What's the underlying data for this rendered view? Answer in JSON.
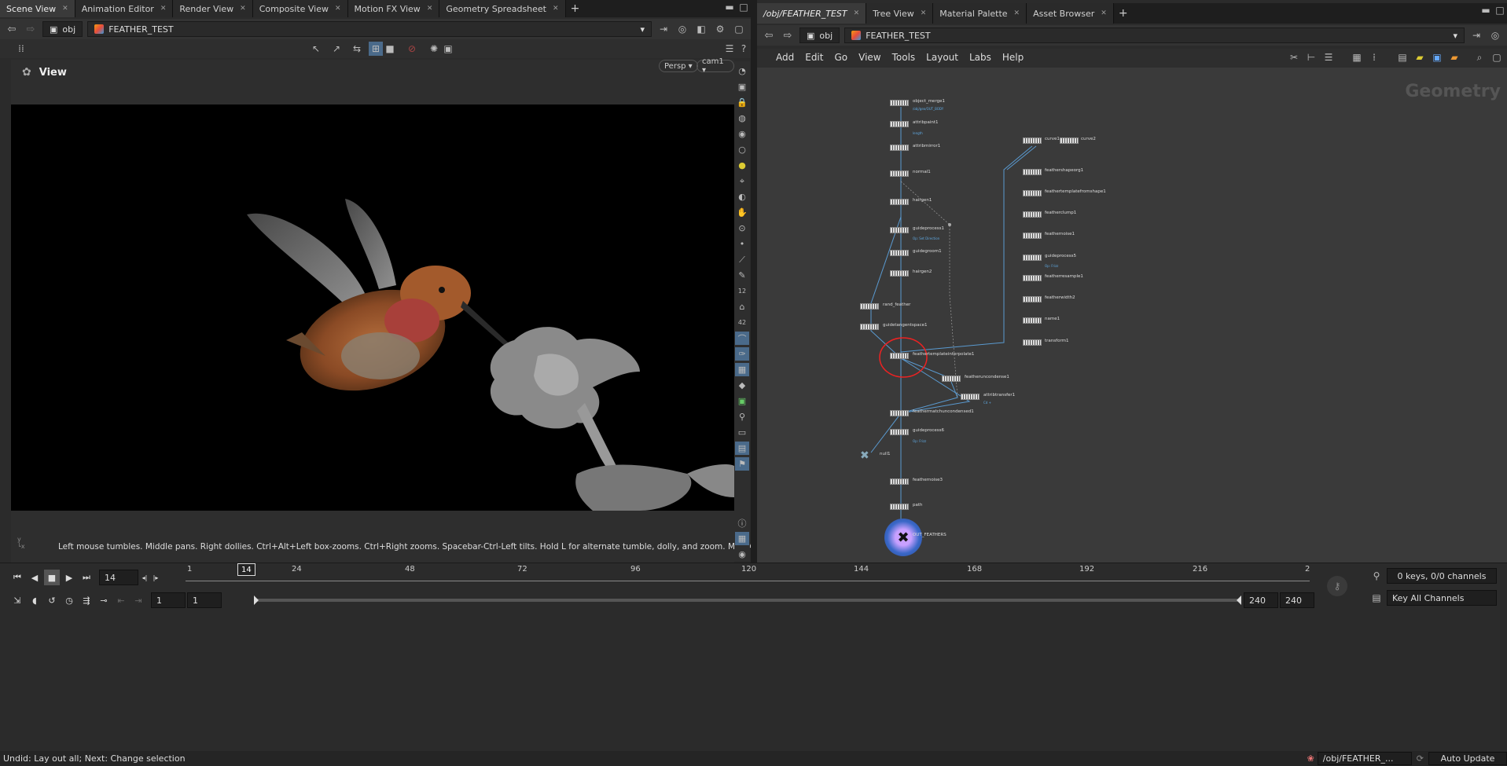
{
  "left_tabs": [
    {
      "label": "Scene View",
      "active": true
    },
    {
      "label": "Animation Editor",
      "active": false
    },
    {
      "label": "Render View",
      "active": false
    },
    {
      "label": "Composite View",
      "active": false
    },
    {
      "label": "Motion FX View",
      "active": false
    },
    {
      "label": "Geometry Spreadsheet",
      "active": false
    }
  ],
  "right_tabs": [
    {
      "label": "/obj/FEATHER_TEST",
      "active": true
    },
    {
      "label": "Tree View",
      "active": false
    },
    {
      "label": "Material Palette",
      "active": false
    },
    {
      "label": "Asset Browser",
      "active": false
    }
  ],
  "left_path": {
    "root": "obj",
    "node": "FEATHER_TEST"
  },
  "right_path": {
    "root": "obj",
    "node": "FEATHER_TEST"
  },
  "viewport": {
    "title": "View",
    "persp_label": "Persp ▾",
    "camera_label": "cam1 ▾",
    "help_text": "Left mouse tumbles. Middle pans. Right dollies. Ctrl+Alt+Left box-zooms. Ctrl+Right zooms. Spacebar-Ctrl-Left tilts. Hold L for alternate tumble, dolly, and zoom. M or Alt+M for First Person Navigation."
  },
  "network": {
    "menu": [
      "Add",
      "Edit",
      "Go",
      "View",
      "Tools",
      "Layout",
      "Labs",
      "Help"
    ],
    "context_label": "Geometry",
    "nodes": [
      {
        "label": "object_merge1",
        "sub": "/obj/geo/OUT_BODY"
      },
      {
        "label": "attribpaint1",
        "sub": "length"
      },
      {
        "label": "attribmirror1",
        "sub": ""
      },
      {
        "label": "normal1",
        "sub": ""
      },
      {
        "label": "hairgen1",
        "sub": ""
      },
      {
        "label": "guideprocess1",
        "sub": "Op: Set Direction"
      },
      {
        "label": "guidegroom1",
        "sub": ""
      },
      {
        "label": "hairgen2",
        "sub": ""
      },
      {
        "label": "rand_feather",
        "sub": ""
      },
      {
        "label": "guidetangentspace1",
        "sub": ""
      },
      {
        "label": "feathertemplateinterpolate1",
        "sub": ""
      },
      {
        "label": "featheruncondense1",
        "sub": ""
      },
      {
        "label": "attribtransfer1",
        "sub": "Cd +"
      },
      {
        "label": "feathermatchuncondensed1",
        "sub": ""
      },
      {
        "label": "guideprocess6",
        "sub": "Op: Frizz"
      },
      {
        "label": "null1",
        "sub": ""
      },
      {
        "label": "feathernoise3",
        "sub": ""
      },
      {
        "label": "path",
        "sub": ""
      },
      {
        "label": "OUT_FEATHERS",
        "sub": ""
      },
      {
        "label": "curve1",
        "sub": ""
      },
      {
        "label": "curve2",
        "sub": ""
      },
      {
        "label": "feathershapeorg1",
        "sub": ""
      },
      {
        "label": "feathertemplatefromshape1",
        "sub": ""
      },
      {
        "label": "featherclump1",
        "sub": ""
      },
      {
        "label": "feathernoise1",
        "sub": ""
      },
      {
        "label": "guideprocess5",
        "sub": "Op: Frizz"
      },
      {
        "label": "featherresample1",
        "sub": ""
      },
      {
        "label": "featherwidth2",
        "sub": ""
      },
      {
        "label": "name1",
        "sub": ""
      },
      {
        "label": "transform1",
        "sub": ""
      }
    ]
  },
  "timeline": {
    "current_frame": "14",
    "ticks": [
      "1",
      "24",
      "48",
      "72",
      "96",
      "120",
      "144",
      "168",
      "192",
      "216",
      "2"
    ],
    "range_start": "1",
    "range_start2": "1",
    "range_end": "240",
    "range_end2": "240",
    "keys_label": "0 keys, 0/0 channels",
    "key_all_label": "Key All Channels"
  },
  "status": {
    "message": "Undid: Lay out all; Next: Change selection",
    "path": "/obj/FEATHER_...",
    "update_mode": "Auto Update"
  }
}
